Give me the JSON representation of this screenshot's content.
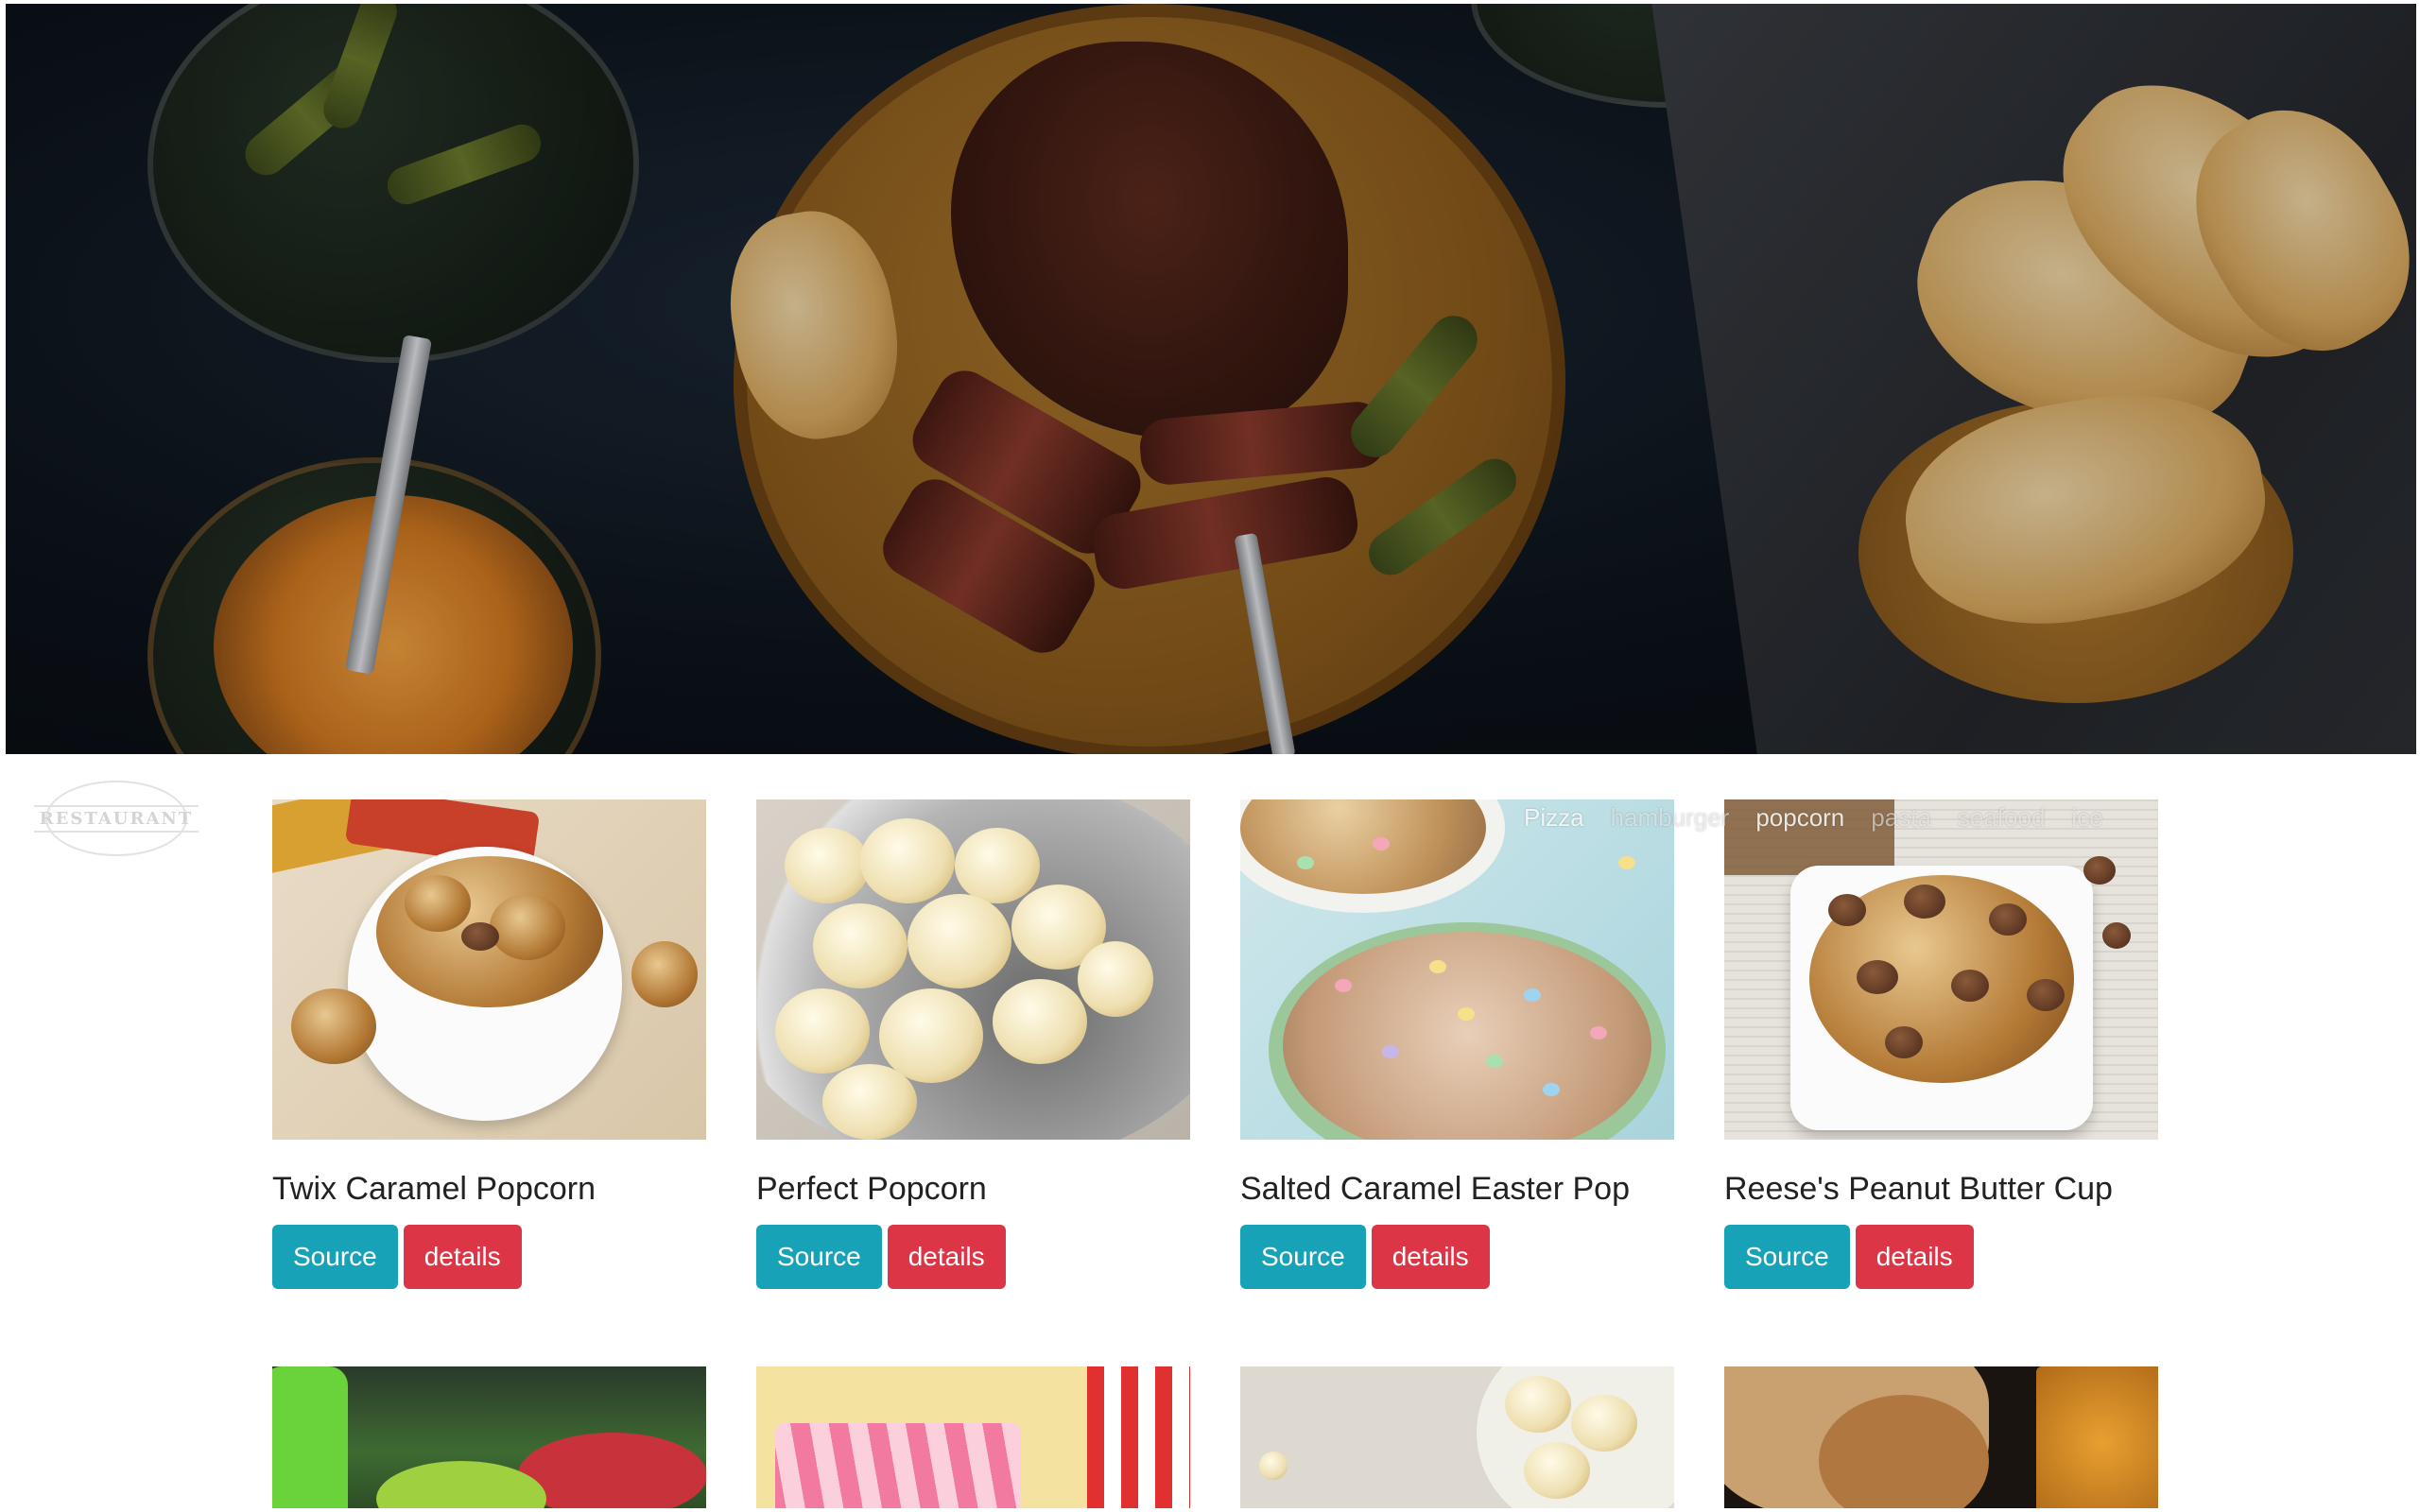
{
  "hero": {
    "image_alt": "Grilled steak on a wooden board with bread, pickles and slaw"
  },
  "logo": {
    "text": "RESTAURANT"
  },
  "categories": [
    "Pizza",
    "hamburger",
    "popcorn",
    "pasta",
    "seafood",
    "ice"
  ],
  "recipes": [
    {
      "title": "Twix Caramel Popcorn",
      "source_label": "Source",
      "details_label": "details"
    },
    {
      "title": "Perfect Popcorn",
      "source_label": "Source",
      "details_label": "details"
    },
    {
      "title": "Salted Caramel Easter Pop",
      "source_label": "Source",
      "details_label": "details"
    },
    {
      "title": "Reese's Peanut Butter Cup",
      "source_label": "Source",
      "details_label": "details"
    }
  ],
  "colors": {
    "source_button": "#17a2b8",
    "details_button": "#dc3545",
    "title_text": "#222222"
  }
}
